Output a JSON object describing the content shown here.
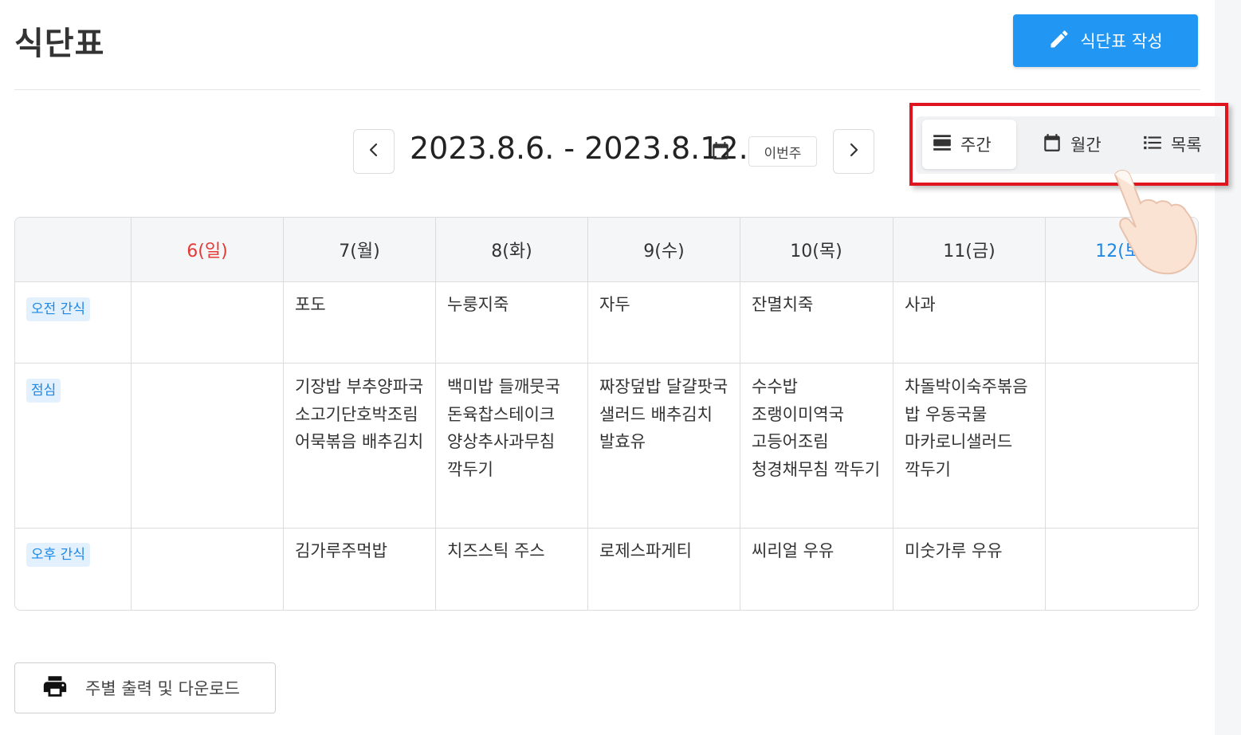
{
  "page": {
    "title": "식단표"
  },
  "toolbar": {
    "write_label": "식단표 작성"
  },
  "date_nav": {
    "range": "2023.8.6. - 2023.8.12.",
    "this_week_label": "이번주"
  },
  "view_switch": {
    "options": [
      {
        "label": "주간",
        "icon": "week-view-icon",
        "active": true
      },
      {
        "label": "월간",
        "icon": "calendar-icon",
        "active": false
      },
      {
        "label": "목록",
        "icon": "list-icon",
        "active": false
      }
    ]
  },
  "table": {
    "days": [
      "6(일)",
      "7(월)",
      "8(화)",
      "9(수)",
      "10(목)",
      "11(금)",
      "12(토)"
    ],
    "rows": [
      {
        "meal": "오전 간식",
        "cells": [
          "",
          "포도",
          "누룽지죽",
          "자두",
          "잔멸치죽",
          "사과",
          ""
        ]
      },
      {
        "meal": "점심",
        "cells": [
          "",
          "기장밥 부추양파국 소고기단호박조림 어묵볶음 배추김치",
          "백미밥 들깨뭇국 돈육찹스테이크 양상추사과무침 깍두기",
          "짜장덮밥 달걀팟국 샐러드 배추김치 발효유",
          "수수밥 조랭이미역국 고등어조림 청경채무침 깍두기",
          "차돌박이숙주볶음밥 우동국물 마카로니샐러드 깍두기",
          ""
        ]
      },
      {
        "meal": "오후 간식",
        "cells": [
          "",
          "김가루주먹밥",
          "치즈스틱 주스",
          "로제스파게티",
          "씨리얼 우유",
          "미숫가루 우유",
          ""
        ]
      }
    ]
  },
  "footer": {
    "print_label": "주별 출력 및 다운로드"
  },
  "colors": {
    "primary": "#2196f3",
    "sunday": "#e53935",
    "saturday": "#1e88e5",
    "tag_bg": "#e3f0fd",
    "highlight": "#e0141e"
  }
}
